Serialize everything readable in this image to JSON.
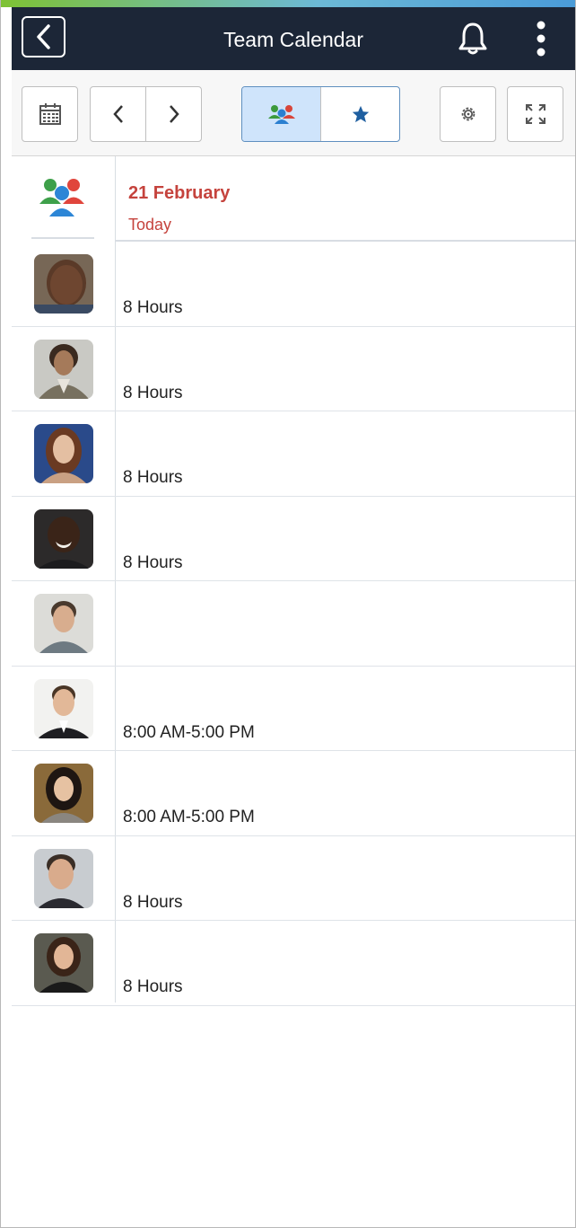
{
  "header": {
    "title": "Team Calendar",
    "back_icon": "chevron-left-icon",
    "notification_icon": "bell-icon",
    "menu_icon": "more-vertical-icon",
    "background_color": "#1c2637"
  },
  "toolbar": {
    "calendar_icon": "calendar-icon",
    "prev_icon": "chevron-left-icon",
    "next_icon": "chevron-right-icon",
    "team_view_icon": "team-icon",
    "favorites_view_icon": "star-icon",
    "settings_icon": "gear-icon",
    "expand_icon": "expand-icon",
    "active_view": "team"
  },
  "calendar": {
    "date": "21 February",
    "subtitle": "Today",
    "accent_color": "#c5433d",
    "rows": [
      {
        "value": "8 Hours"
      },
      {
        "value": "8 Hours"
      },
      {
        "value": "8 Hours"
      },
      {
        "value": "8 Hours"
      },
      {
        "value": ""
      },
      {
        "value": "8:00 AM-5:00 PM"
      },
      {
        "value": "8:00 AM-5:00 PM"
      },
      {
        "value": "8 Hours"
      },
      {
        "value": "8 Hours"
      }
    ]
  }
}
